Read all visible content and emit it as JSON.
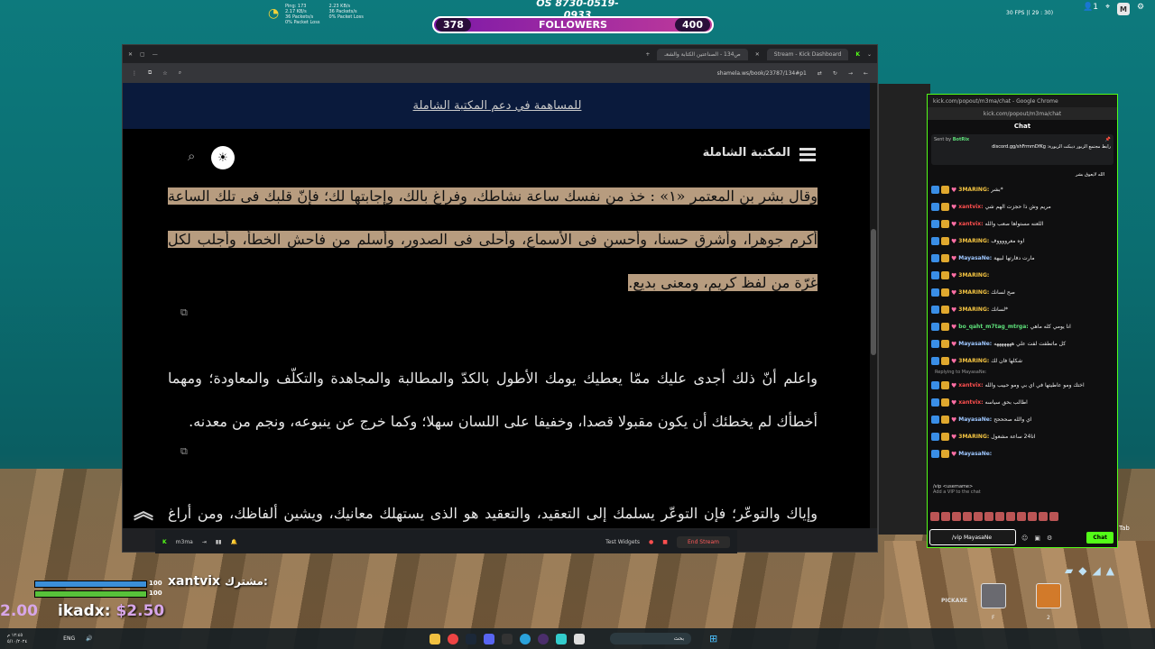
{
  "hud": {
    "number_top": "OS 8730-0519-0933",
    "followers_left": "378",
    "followers_label": "FOLLOWERS",
    "followers_right": "400",
    "fps": "30 FPS |( 29 : 30)",
    "net_stats_left": "Ping: 173\n2.17 KB/s\n36 Packets/s\n0% Packet Loss",
    "net_stats_right": "2.23 KB/s\n36 Packets/s\n0% Packet Loss",
    "top_right_count": "1",
    "avatar_letter": "M"
  },
  "browser": {
    "tab_active": "ص134 - الصناعتين الكتابة والشعـ",
    "tab_2": "Stream - Kick Dashboard",
    "url": "shamela.ws/book/23787/134#p1"
  },
  "site": {
    "banner_link": "للمساهمة في دعم المكتبة الشاملة",
    "title": "المكتبة الشاملة",
    "para1": "وقال بشر بن المعتمر «١» : خذ من نفسك ساعة نشاطك، وفراغ بالك، وإجابتها لك؛ فإنّ قلبك فى تلك الساعة أكرم جوهرا، وأشرق حسنا، وأحسن فى الأسماع، وأحلى فى الصدور، وأسلم من فاحش الخطأ، وأجلب لكل غرّة من لفظ كريم، ومعنى بديع.",
    "para2": "واعلم أنّ ذلك أجدى عليك ممّا يعطيك يومك الأطول بالكدّ والمطالبة والمجاهدة والتكلّف والمعاودة؛ ومهما أخطأك لم يخطئك أن يكون مقبولا قصدا، وخفيفا على اللسان سهلا؛ وكما خرج عن ينبوعه، ونجم من معدنه.",
    "para3": "وإياك والتوعّر؛ فإن التوعّر يسلمك إلى التعقيد، والتعقيد هو الذى يستهلك معانيك، ويشين ألفاظك، ومن أراغ معنى كريما فليلتمس له لفظا كريما؛ فإنّ حقّ المعنى الشريف اللفظ الشريف، ومن حقهما"
  },
  "kick_bar": {
    "channel": "m3ma",
    "test_widgets": "Test Widgets",
    "end_stream": "End Stream"
  },
  "chat": {
    "window_title": "kick.com/popout/m3ma/chat - Google Chrome",
    "url": "kick.com/popout/m3ma/chat",
    "title": "Chat",
    "pinned_by": "Sent by",
    "pinned_user": "BotRix",
    "pinned_msg": "رابط مجتمع الزبور ديبكت الزبورة: discord.gg/shFrmmDfKg",
    "pinned_prev": "الله لايعوق بشر",
    "messages": [
      {
        "user": "3MARING:",
        "text": "*بشر",
        "color": "#f5c542"
      },
      {
        "user": "xantvix:",
        "text": "مريم وش ذا حجزت الهم شي",
        "color": "#ff4f4f"
      },
      {
        "user": "xantvix:",
        "text": "اللعنه مستواها صعب والله",
        "color": "#ff4f4f"
      },
      {
        "user": "3MARING:",
        "text": "اوه معرووووف",
        "color": "#f5c542"
      },
      {
        "user": "MayasaNe:",
        "text": "مارت دفارتها لبيهة",
        "color": "#9ec7ff"
      },
      {
        "user": "3MARING:",
        "text": "",
        "color": "#f5c542"
      },
      {
        "user": "3MARING:",
        "text": "صح لسانك",
        "color": "#f5c542"
      },
      {
        "user": "3MARING:",
        "text": "*لسانك",
        "color": "#f5c542"
      },
      {
        "user": "bo_qaht_m7tag_mtrga:",
        "text": "انا يومي كله ماهي",
        "color": "#5ee07a"
      },
      {
        "user": "MayasaNe:",
        "text": "كل ماتطفت لفت علي هههههههه",
        "color": "#9ec7ff"
      },
      {
        "user": "3MARING:",
        "text": "شكلها فان لك",
        "color": "#f5c542"
      },
      {
        "user": "xantvix:",
        "text": "اختك ومو عاطيتها في اي بي ومو حبيب والله",
        "color": "#ff4f4f"
      },
      {
        "user": "xantvix:",
        "text": "اطالب بحق سياسه",
        "color": "#ff4f4f"
      },
      {
        "user": "MayasaNe:",
        "text": "اي والله صحححح",
        "color": "#9ec7ff"
      },
      {
        "user": "3MARING:",
        "text": "انا24 ساعة مشعول",
        "color": "#f5c542"
      },
      {
        "user": "MayasaNe:",
        "text": "",
        "color": "#9ec7ff"
      }
    ],
    "replying_to": "Replying to MayasaNe:",
    "vip_cmd": "/vip <username>",
    "vip_desc": "Add a VIP to the chat",
    "input_value": "/vip MayasaNe",
    "send_label": "Chat"
  },
  "player": {
    "prefix": "مشترك:",
    "name": "xantvix",
    "shield": "100",
    "health": "100",
    "shield_fill": 1.0,
    "health_fill": 1.0,
    "second_name": "ikadx:",
    "second_amount": "$2.50",
    "left_amount": "2.00"
  },
  "inventory": {
    "pickaxe": "PICKAXE",
    "slot1_key": "F",
    "slot2_key": "2",
    "tab_label": "Tab"
  },
  "taskbar": {
    "lang": "ENG",
    "search_placeholder": "بحث",
    "time": "١٢:٤٥ م",
    "date": "٥/١٠/٢٠٢٤"
  }
}
